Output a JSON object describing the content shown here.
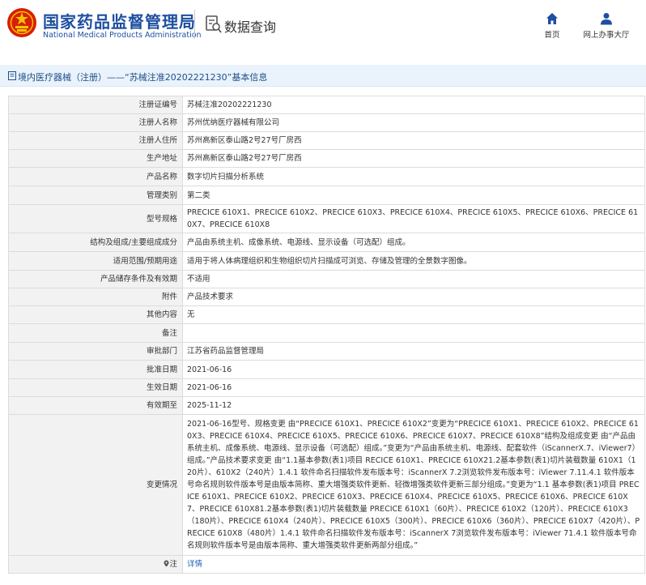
{
  "header": {
    "org_name_cn": "国家药品监督管理局",
    "org_name_en": "National Medical Products Administration",
    "section_title": "数据查询",
    "nav": [
      {
        "label": "首页",
        "icon": "home-icon"
      },
      {
        "label": "网上办事大厅",
        "icon": "user-icon"
      }
    ]
  },
  "title_bar": {
    "text": "境内医疗器械（注册）——“苏械注准20202221230”基本信息"
  },
  "colors": {
    "brand_blue": "#1e4fa0",
    "title_bar_bg": "#eaf3fb",
    "label_bg": "#f2f2f2",
    "border": "#dcdcdc",
    "link": "#1e62b8"
  },
  "rows": [
    {
      "label": "注册证编号",
      "value": "苏械注准20202221230"
    },
    {
      "label": "注册人名称",
      "value": "苏州优纳医疗器械有限公司"
    },
    {
      "label": "注册人住所",
      "value": "苏州高新区泰山路2号27号厂房西"
    },
    {
      "label": "生产地址",
      "value": "苏州高新区泰山路2号27号厂房西"
    },
    {
      "label": "产品名称",
      "value": "数字切片扫描分析系统"
    },
    {
      "label": "管理类别",
      "value": "第二类"
    },
    {
      "label": "型号规格",
      "value": "PRECICE 610X1、PRECICE 610X2、PRECICE 610X3、PRECICE 610X4、PRECICE 610X5、PRECICE 610X6、PRECICE 610X7、PRECICE 610X8"
    },
    {
      "label": "结构及组成/主要组成成分",
      "value": "产品由系统主机、成像系统、电源线、显示设备（可选配）组成。"
    },
    {
      "label": "适用范围/预期用途",
      "value": "适用于将人体病理组织和生物组织切片扫描成可浏览、存储及管理的全景数字图像。"
    },
    {
      "label": "产品储存条件及有效期",
      "value": "不适用"
    },
    {
      "label": "附件",
      "value": "产品技术要求"
    },
    {
      "label": "其他内容",
      "value": "无"
    },
    {
      "label": "备注",
      "value": ""
    },
    {
      "label": "审批部门",
      "value": "江苏省药品监督管理局"
    },
    {
      "label": "批准日期",
      "value": "2021-06-16"
    },
    {
      "label": "生效日期",
      "value": "2021-06-16"
    },
    {
      "label": "有效期至",
      "value": "2025-11-12"
    },
    {
      "label": "变更情况",
      "value": "2021-06-16型号、规格变更 由“PRECICE 610X1、PRECICE 610X2”变更为“PRECICE 610X1、PRECICE 610X2、PRECICE 610X3、PRECICE 610X4、PRECICE 610X5、PRECICE 610X6、PRECICE 610X7、PRECICE 610X8”结构及组成变更 由“产品由系统主机、成像系统、电源线、显示设备（可选配）组成。”变更为“产品由系统主机、电源线、配套软件（iScannerX.7、iViewer7）组成。”产品技术要求变更 由“1.1基本参数(表1)项目 RECICE 610X1、PRECICE 610X21.2基本参数(表1)切片装载数量 610X1（120片）、610X2（240片）1.4.1 软件命名扫描软件发布版本号：iScannerX 7.2浏览软件发布版本号：iViewer 7.11.4.1 软件版本号命名规则软件版本号是由版本简称、重大增强类软件更新、轻微增强类软件更新三部分组成。”变更为“1.1 基本参数(表1)项目 PRECICE 610X1、PRECICE 610X2、PRECICE 610X3、PRECICE 610X4、PRECICE 610X5、PRECICE 610X6、PRECICE 610X7、PRECICE 610X81.2基本参数(表1)切片装载数量 PRECICE 610X1（60片）、PRECICE 610X2（120片）、PRECICE 610X3（180片）、PRECICE 610X4（240片）、PRECICE 610X5（300片）、PRECICE 610X6（360片）、PRECICE 610X7（420片）、PRECICE 610X8（480片）1.4.1 软件命名扫描软件发布版本号：iScannerX 7浏览软件发布版本号：iViewer 71.4.1 软件版本号命名规则软件版本号是由版本简称、重大增强类软件更新两部分组成。”"
    }
  ],
  "note_row": {
    "label": "注",
    "icon": "pin-icon",
    "link_text": "详情"
  }
}
